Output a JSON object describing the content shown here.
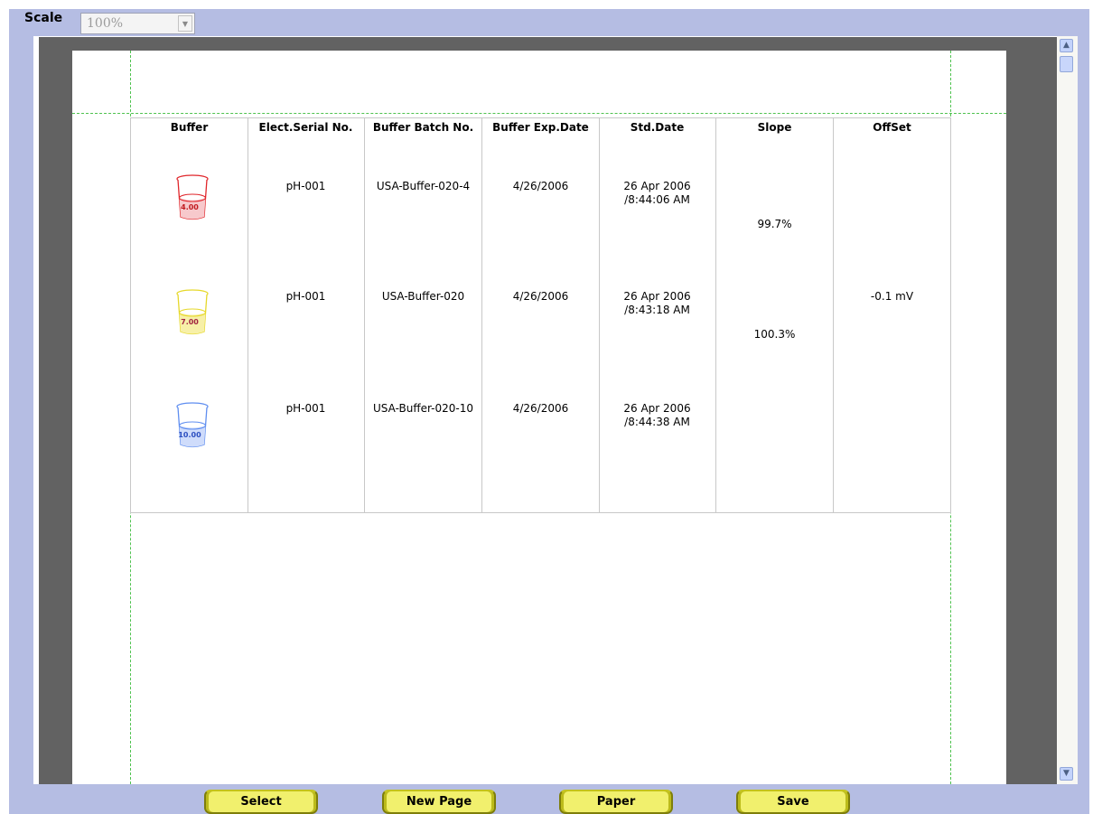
{
  "toolbar": {
    "scale_label": "Scale",
    "scale_value": "100%"
  },
  "table": {
    "headers": [
      "Buffer",
      "Elect.Serial No.",
      "Buffer Batch No.",
      "Buffer Exp.Date",
      "Std.Date",
      "Slope",
      "OffSet"
    ],
    "rows": [
      {
        "buffer_value": "4.00",
        "buffer_color": "#e0262b",
        "serial": "pH-001",
        "batch": "USA-Buffer-020-4",
        "exp_date": "4/26/2006",
        "std_date_line1": "26 Apr 2006",
        "std_date_line2": "/8:44:06 AM"
      },
      {
        "buffer_value": "7.00",
        "buffer_color": "#e6d82a",
        "serial": "pH-001",
        "batch": "USA-Buffer-020",
        "exp_date": "4/26/2006",
        "std_date_line1": "26 Apr 2006",
        "std_date_line2": "/8:43:18 AM"
      },
      {
        "buffer_value": "10.00",
        "buffer_color": "#5f8ef0",
        "serial": "pH-001",
        "batch": "USA-Buffer-020-10",
        "exp_date": "4/26/2006",
        "std_date_line1": "26 Apr 2006",
        "std_date_line2": "/8:44:38 AM"
      }
    ],
    "slopes": [
      "99.7%",
      "100.3%"
    ],
    "offset": "-0.1 mV"
  },
  "buttons": {
    "select": "Select",
    "new_page": "New Page",
    "paper": "Paper",
    "save": "Save"
  },
  "icons": {
    "scroll_up": "scroll-up-arrow-icon",
    "scroll_down": "scroll-down-arrow-icon",
    "dropdown": "chevron-down-icon",
    "beaker": "beaker-icon"
  },
  "colors": {
    "frame": "#b5bde3",
    "preview_background": "#626262",
    "guide_line": "#4fc24f",
    "button_fill": "#f1f06d"
  }
}
